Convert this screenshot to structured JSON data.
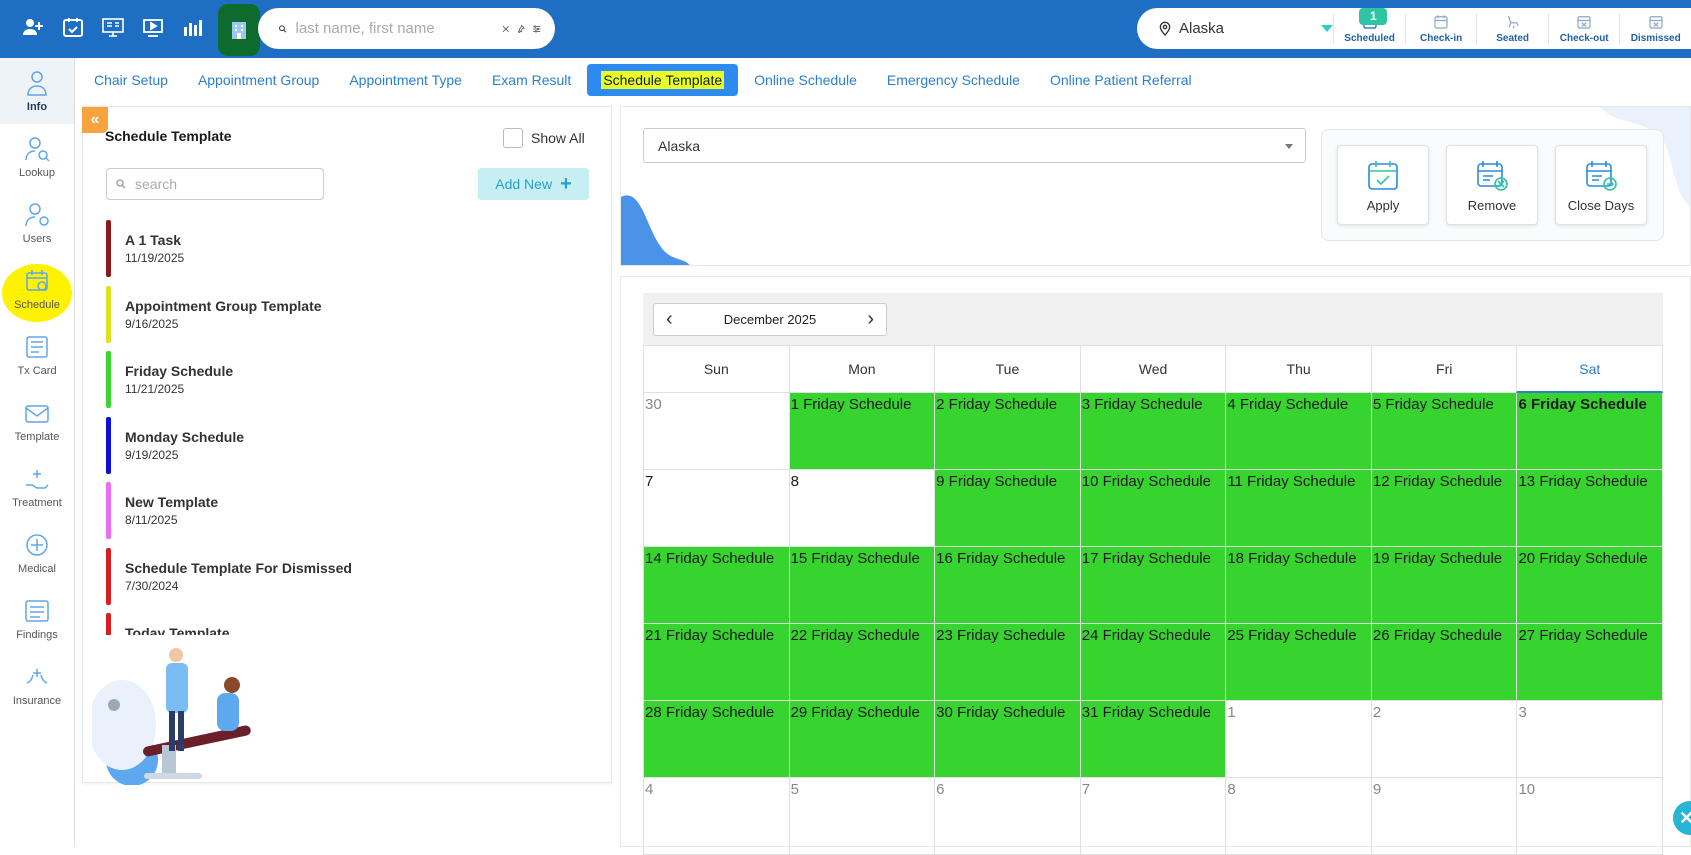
{
  "topbar": {
    "search_placeholder": "last name, first name",
    "location": "Alaska",
    "statuses": [
      {
        "label": "Scheduled",
        "badge": "1"
      },
      {
        "label": "Check-in"
      },
      {
        "label": "Seated"
      },
      {
        "label": "Check-out"
      },
      {
        "label": "Dismissed"
      }
    ]
  },
  "leftnav": {
    "items": [
      {
        "label": "Info"
      },
      {
        "label": "Lookup"
      },
      {
        "label": "Users"
      },
      {
        "label": "Schedule"
      },
      {
        "label": "Tx Card"
      },
      {
        "label": "Template"
      },
      {
        "label": "Treatment"
      },
      {
        "label": "Medical"
      },
      {
        "label": "Findings"
      },
      {
        "label": "Insurance"
      }
    ]
  },
  "tabs": [
    {
      "label": "Chair Setup"
    },
    {
      "label": "Appointment Group"
    },
    {
      "label": "Appointment Type"
    },
    {
      "label": "Exam Result"
    },
    {
      "label": "Schedule Template"
    },
    {
      "label": "Online Schedule"
    },
    {
      "label": "Emergency Schedule"
    },
    {
      "label": "Online Patient Referral"
    }
  ],
  "template_panel": {
    "collapse_glyph": "«",
    "title": "Schedule Template",
    "show_all_label": "Show All",
    "search_placeholder": "search",
    "add_new_label": "Add New",
    "add_new_glyph": "+",
    "templates": [
      {
        "name": "A 1 Task",
        "date": "11/19/2025",
        "color": "#8b1a1a"
      },
      {
        "name": "Appointment Group Template",
        "date": "9/16/2025",
        "color": "#e0e020"
      },
      {
        "name": "Friday Schedule",
        "date": "11/21/2025",
        "color": "#3ad62f"
      },
      {
        "name": "Monday Schedule",
        "date": "9/19/2025",
        "color": "#1010d0"
      },
      {
        "name": "New Template",
        "date": "8/11/2025",
        "color": "#ea6ff0"
      },
      {
        "name": "Schedule Template For Dismissed",
        "date": "7/30/2024",
        "color": "#d42020"
      },
      {
        "name": "Today Template",
        "date": "",
        "color": "#d42020"
      }
    ]
  },
  "schedule_panel": {
    "location_select": "Alaska",
    "actions": [
      {
        "label": "Apply"
      },
      {
        "label": "Remove"
      },
      {
        "label": "Close Days"
      }
    ]
  },
  "calendar": {
    "month_label": "December 2025",
    "prev_glyph": "‹",
    "next_glyph": "›",
    "weekdays": [
      "Sun",
      "Mon",
      "Tue",
      "Wed",
      "Thu",
      "Fri",
      "Sat"
    ],
    "weeks": [
      [
        {
          "t": "30",
          "s": "other"
        },
        {
          "t": "1 Friday Schedule",
          "s": "filled"
        },
        {
          "t": "2 Friday Schedule",
          "s": "filled"
        },
        {
          "t": "3 Friday Schedule",
          "s": "filled"
        },
        {
          "t": "4 Friday Schedule",
          "s": "filled"
        },
        {
          "t": "5 Friday Schedule",
          "s": "filled"
        },
        {
          "t": "6 Friday Schedule",
          "s": "filled bold"
        }
      ],
      [
        {
          "t": "7",
          "s": ""
        },
        {
          "t": "8",
          "s": ""
        },
        {
          "t": "9 Friday Schedule",
          "s": "filled"
        },
        {
          "t": "10 Friday Schedule",
          "s": "filled"
        },
        {
          "t": "11 Friday Schedule",
          "s": "filled"
        },
        {
          "t": "12 Friday Schedule",
          "s": "filled"
        },
        {
          "t": "13 Friday Schedule",
          "s": "filled"
        }
      ],
      [
        {
          "t": "14 Friday Schedule",
          "s": "filled"
        },
        {
          "t": "15 Friday Schedule",
          "s": "filled"
        },
        {
          "t": "16 Friday Schedule",
          "s": "filled"
        },
        {
          "t": "17 Friday Schedule",
          "s": "filled"
        },
        {
          "t": "18 Friday Schedule",
          "s": "filled"
        },
        {
          "t": "19 Friday Schedule",
          "s": "filled"
        },
        {
          "t": "20 Friday Schedule",
          "s": "filled"
        }
      ],
      [
        {
          "t": "21 Friday Schedule",
          "s": "filled"
        },
        {
          "t": "22 Friday Schedule",
          "s": "filled"
        },
        {
          "t": "23 Friday Schedule",
          "s": "filled"
        },
        {
          "t": "24 Friday Schedule",
          "s": "filled"
        },
        {
          "t": "25 Friday Schedule",
          "s": "filled"
        },
        {
          "t": "26 Friday Schedule",
          "s": "filled"
        },
        {
          "t": "27 Friday Schedule",
          "s": "filled"
        }
      ],
      [
        {
          "t": "28 Friday Schedule",
          "s": "filled"
        },
        {
          "t": "29 Friday Schedule",
          "s": "filled"
        },
        {
          "t": "30 Friday Schedule",
          "s": "filled"
        },
        {
          "t": "31 Friday Schedule",
          "s": "filled"
        },
        {
          "t": "1",
          "s": "other"
        },
        {
          "t": "2",
          "s": "other"
        },
        {
          "t": "3",
          "s": "other"
        }
      ],
      [
        {
          "t": "4",
          "s": "other"
        },
        {
          "t": "5",
          "s": "other"
        },
        {
          "t": "6",
          "s": "other"
        },
        {
          "t": "7",
          "s": "other"
        },
        {
          "t": "8",
          "s": "other"
        },
        {
          "t": "9",
          "s": "other"
        },
        {
          "t": "10",
          "s": "other"
        }
      ]
    ]
  },
  "colors": {
    "topbar": "#1e6fc4",
    "schedule_fill": "#37d42f",
    "accent": "#2a7fd0"
  }
}
